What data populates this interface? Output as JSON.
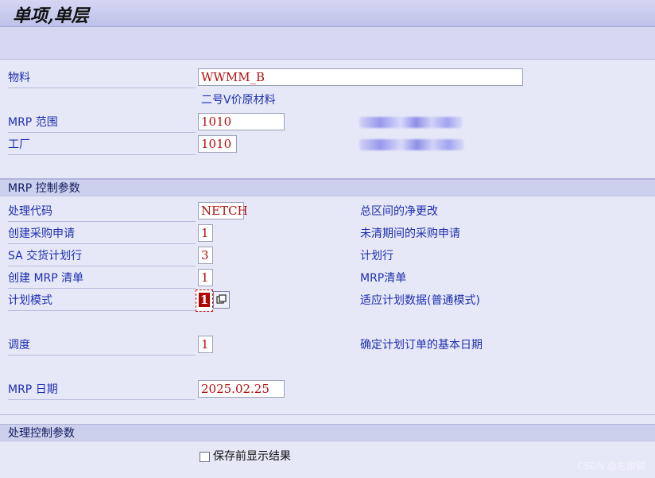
{
  "title": "单项,单层",
  "material": {
    "label": "物料",
    "value": "WWMM_B",
    "description": "二号V价原材料"
  },
  "mrp_area": {
    "label": "MRP 范围",
    "value": "1010"
  },
  "plant": {
    "label": "工厂",
    "value": "1010"
  },
  "mrp_control": {
    "header": "MRP 控制参数",
    "rows": [
      {
        "label": "处理代码",
        "value": "NETCH",
        "description": "总区间的净更改"
      },
      {
        "label": "创建采购申请",
        "value": "1",
        "description": "未清期间的采购申请"
      },
      {
        "label": "SA 交货计划行",
        "value": "3",
        "description": "计划行"
      },
      {
        "label": "创建 MRP 清单",
        "value": "1",
        "description": "MRP清单"
      },
      {
        "label": "计划模式",
        "value": "1",
        "description": "适应计划数据(普通模式)"
      },
      {
        "label": "调度",
        "value": "1",
        "description": "确定计划订单的基本日期"
      },
      {
        "label": "MRP 日期",
        "value": "2025.02.25"
      }
    ]
  },
  "process_control": {
    "header": "处理控制参数",
    "checkbox_label": "保存前显示结果",
    "checked": false
  },
  "watermark": "CSDN @左甜甜",
  "icons": {
    "value_help": "value-help-icon",
    "redacted": "redacted-blur"
  }
}
